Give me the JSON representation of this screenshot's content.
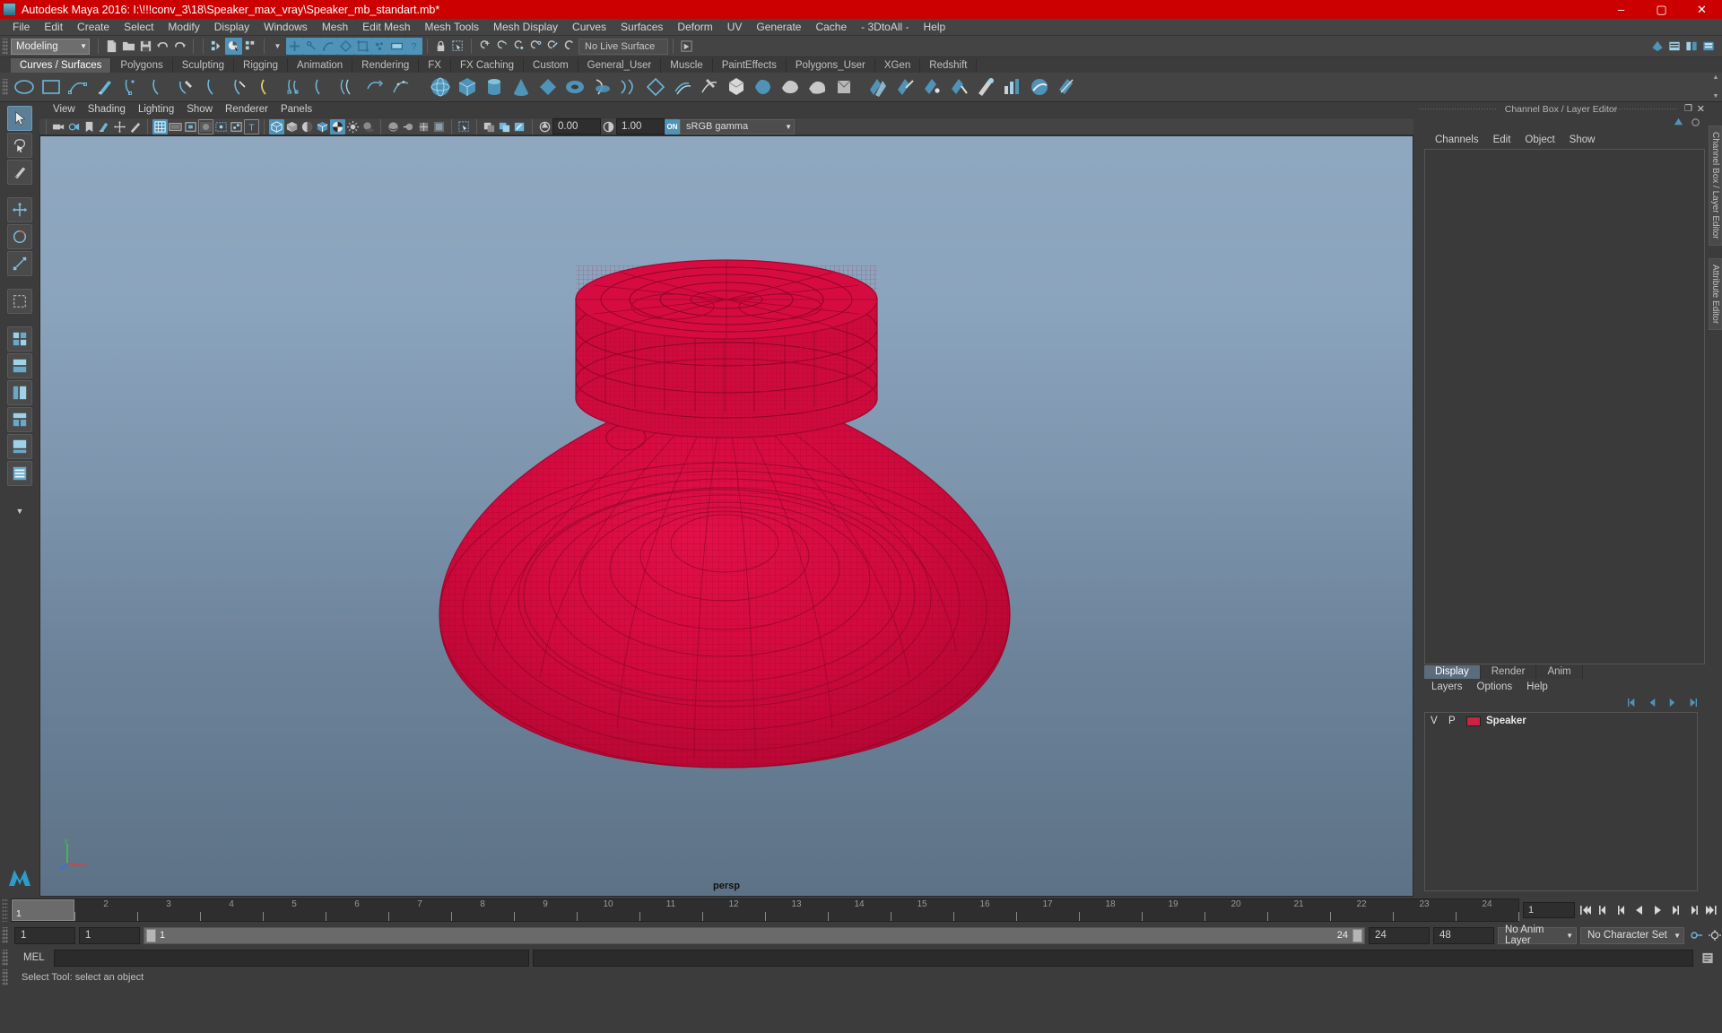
{
  "titlebar": {
    "title": "Autodesk Maya 2016: I:\\!!!conv_3\\18\\Speaker_max_vray\\Speaker_mb_standart.mb*",
    "minimize": "–",
    "maximize": "▢",
    "close": "✕"
  },
  "menubar": {
    "items": [
      "File",
      "Edit",
      "Create",
      "Select",
      "Modify",
      "Display",
      "Windows",
      "Mesh",
      "Edit Mesh",
      "Mesh Tools",
      "Mesh Display",
      "Curves",
      "Surfaces",
      "Deform",
      "UV",
      "Generate",
      "Cache",
      "- 3DtoAll -",
      "Help"
    ]
  },
  "statusline": {
    "mode": "Modeling",
    "mode_arrow": "▼",
    "live_surface": "No Live Surface",
    "dropdown_arrow": "▼"
  },
  "shelf": {
    "tabs": [
      "Curves / Surfaces",
      "Polygons",
      "Sculpting",
      "Rigging",
      "Animation",
      "Rendering",
      "FX",
      "FX Caching",
      "Custom",
      "General_User",
      "Muscle",
      "PaintEffects",
      "Polygons_User",
      "XGen",
      "Redshift"
    ],
    "active_tab": "Curves / Surfaces",
    "up_arrow": "▲",
    "down_arrow": "▼"
  },
  "viewport": {
    "menus": [
      "View",
      "Shading",
      "Lighting",
      "Show",
      "Renderer",
      "Panels"
    ],
    "camera_label": "persp",
    "exposure_value": "0.00",
    "gamma_value": "1.00",
    "color_management": "sRGB gamma",
    "cm_arrow": "▼",
    "cm_toggle": "ON",
    "axis": {
      "x": "x",
      "y": "y",
      "z": "z"
    }
  },
  "channelbox": {
    "dock_title": "Channel Box / Layer Editor",
    "close": "✕",
    "float": "❐",
    "menus": [
      "Channels",
      "Edit",
      "Object",
      "Show"
    ]
  },
  "layereditor": {
    "tabs": [
      "Display",
      "Render",
      "Anim"
    ],
    "active_tab": "Display",
    "menus": [
      "Layers",
      "Options",
      "Help"
    ],
    "columns": {
      "visible": "V",
      "playback": "P"
    },
    "layers": [
      {
        "visible": "V",
        "playback": "P",
        "color": "#cc2244",
        "name": "Speaker"
      }
    ]
  },
  "verttabs": {
    "items": [
      "Channel Box / Layer Editor",
      "Attribute Editor"
    ]
  },
  "timeline": {
    "ticks": [
      "1",
      "2",
      "3",
      "4",
      "5",
      "6",
      "7",
      "8",
      "9",
      "10",
      "11",
      "12",
      "13",
      "14",
      "15",
      "16",
      "17",
      "18",
      "19",
      "20",
      "21",
      "22",
      "23",
      "24"
    ],
    "current_frame": "1",
    "frame_field": "1",
    "playback": {
      "go_to_start": "|◀◀",
      "step_back_key": "◀|",
      "step_back": "|◀",
      "play_back": "◀",
      "play_forward": "▶",
      "step_forward": "▶|",
      "step_forward_key": "|▶",
      "go_to_end": "▶▶|"
    }
  },
  "rangeslider": {
    "anim_start": "1",
    "range_start": "1",
    "bar_start": "1",
    "bar_end": "24",
    "range_end": "24",
    "anim_end": "48",
    "anim_layer": "No Anim Layer",
    "anim_layer_arrow": "▼",
    "character_set": "No Character Set",
    "character_set_arrow": "▼"
  },
  "melline": {
    "label": "MEL",
    "input_value": "",
    "output_value": ""
  },
  "helpline": {
    "text": "Select Tool: select an object"
  },
  "colors": {
    "title_bar": "#cc0000",
    "accent_blue": "#4f94b8",
    "wireframe": "#d4083e",
    "panel_bg": "#3c3c3c",
    "layer_swatch": "#cc2244"
  }
}
